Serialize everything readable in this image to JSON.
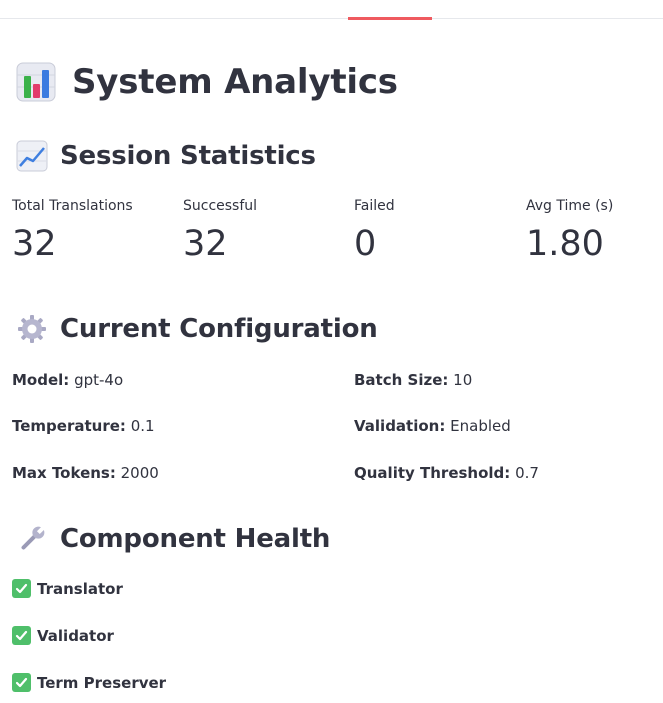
{
  "page": {
    "title": "System Analytics",
    "title_icon": "bar-chart-icon"
  },
  "session_statistics": {
    "heading": "Session Statistics",
    "icon": "chart-increasing-icon",
    "metrics": [
      {
        "label": "Total Translations",
        "value": "32"
      },
      {
        "label": "Successful",
        "value": "32"
      },
      {
        "label": "Failed",
        "value": "0"
      },
      {
        "label": "Avg Time (s)",
        "value": "1.80"
      }
    ]
  },
  "current_configuration": {
    "heading": "Current Configuration",
    "icon": "gear-icon",
    "items": [
      {
        "label": "Model:",
        "value": "gpt-4o"
      },
      {
        "label": "Batch Size:",
        "value": "10"
      },
      {
        "label": "Temperature:",
        "value": "0.1"
      },
      {
        "label": "Validation:",
        "value": "Enabled"
      },
      {
        "label": "Max Tokens:",
        "value": "2000"
      },
      {
        "label": "Quality Threshold:",
        "value": "0.7"
      }
    ]
  },
  "component_health": {
    "heading": "Component Health",
    "icon": "wrench-icon",
    "items": [
      {
        "name": "Translator",
        "status_icon": "check-box-icon"
      },
      {
        "name": "Validator",
        "status_icon": "check-box-icon"
      },
      {
        "name": "Term Preserver",
        "status_icon": "check-box-icon"
      }
    ]
  },
  "colors": {
    "text": "#31333f",
    "accent_tab": "#ef5a5f",
    "check_green": "#4fbf6a"
  }
}
